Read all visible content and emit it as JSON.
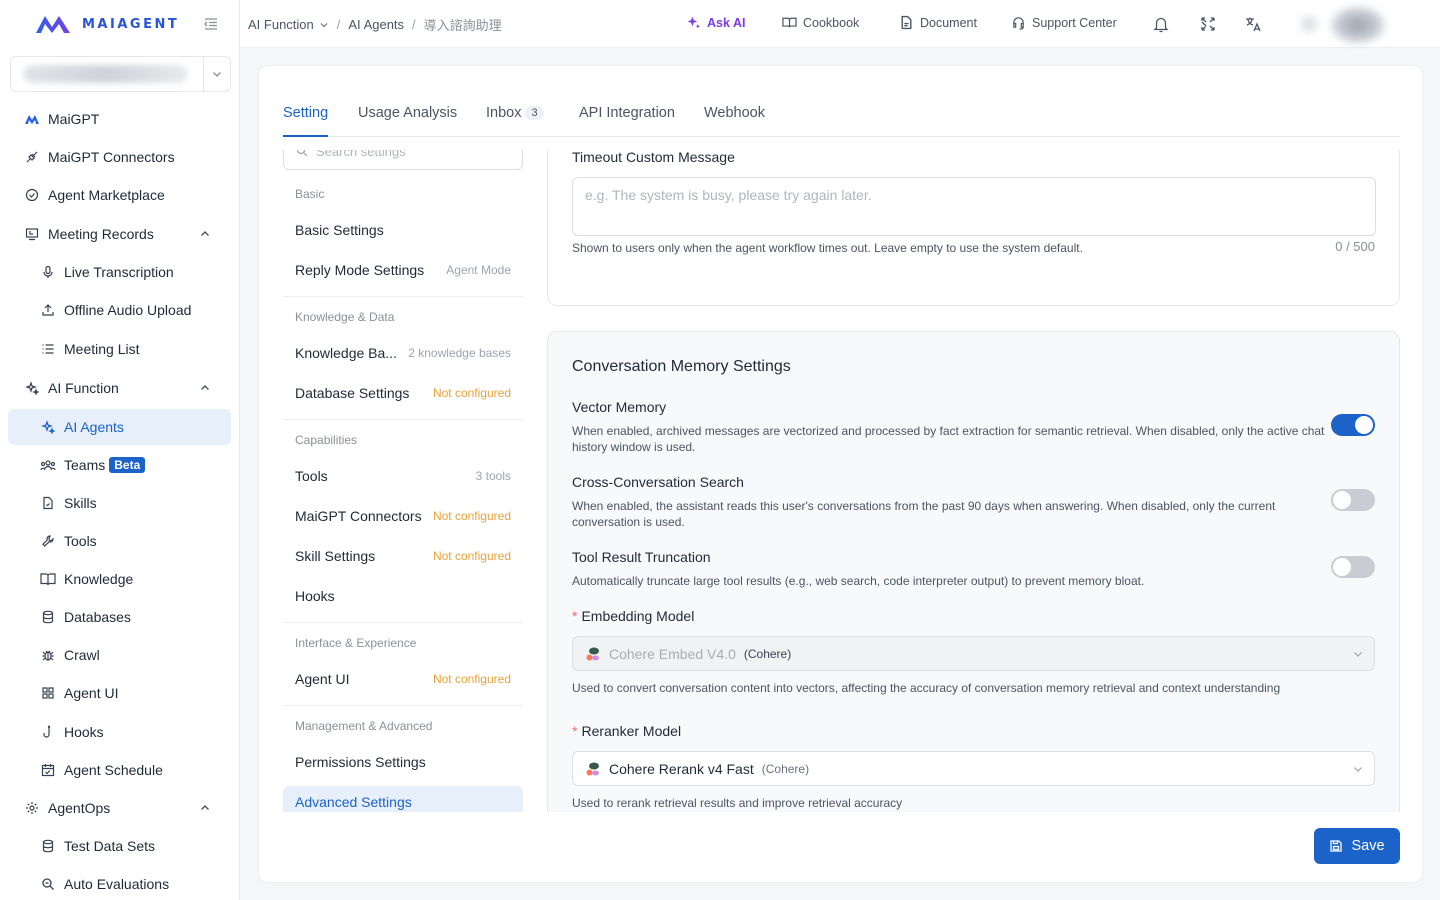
{
  "app": {
    "logo_text": "MAIAGENT"
  },
  "sidebar": {
    "items": [
      {
        "label": "MaiGPT",
        "icon": "maigpt-icon"
      },
      {
        "label": "MaiGPT Connectors",
        "icon": "connector-icon"
      },
      {
        "label": "Agent Marketplace",
        "icon": "marketplace-icon"
      },
      {
        "label": "Meeting Records",
        "icon": "meeting-icon",
        "expanded": true
      },
      {
        "label": "Live Transcription",
        "icon": "microphone-icon"
      },
      {
        "label": "Offline Audio Upload",
        "icon": "upload-icon"
      },
      {
        "label": "Meeting List",
        "icon": "list-icon"
      },
      {
        "label": "AI Function",
        "icon": "sparkle-icon",
        "expanded": true
      },
      {
        "label": "AI Agents",
        "icon": "sparkle-icon",
        "active": true
      },
      {
        "label": "Teams",
        "icon": "team-icon",
        "badge": "Beta"
      },
      {
        "label": "Skills",
        "icon": "skill-icon"
      },
      {
        "label": "Tools",
        "icon": "wrench-icon"
      },
      {
        "label": "Knowledge",
        "icon": "book-icon"
      },
      {
        "label": "Databases",
        "icon": "database-icon"
      },
      {
        "label": "Crawl",
        "icon": "bug-icon"
      },
      {
        "label": "Agent UI",
        "icon": "grid-icon"
      },
      {
        "label": "Hooks",
        "icon": "hook-icon"
      },
      {
        "label": "Agent Schedule",
        "icon": "calendar-icon"
      },
      {
        "label": "AgentOps",
        "icon": "agentops-icon",
        "expanded": true
      },
      {
        "label": "Test Data Sets",
        "icon": "database-icon"
      },
      {
        "label": "Auto Evaluations",
        "icon": "search-icon"
      }
    ]
  },
  "topbar": {
    "breadcrumb": [
      "AI Function",
      "AI Agents",
      "導入諮詢助理"
    ],
    "ask_ai": "Ask AI",
    "cookbook": "Cookbook",
    "document": "Document",
    "support": "Support Center"
  },
  "tabs": [
    {
      "label": "Setting",
      "active": true
    },
    {
      "label": "Usage Analysis"
    },
    {
      "label": "Inbox",
      "count": "3"
    },
    {
      "label": "API Integration"
    },
    {
      "label": "Webhook"
    }
  ],
  "settings_nav": {
    "search_placeholder": "Search settings",
    "groups": [
      {
        "title": "Basic",
        "items": [
          {
            "label": "Basic Settings",
            "meta": ""
          },
          {
            "label": "Reply Mode Settings",
            "meta": "Agent Mode"
          }
        ]
      },
      {
        "title": "Knowledge & Data",
        "items": [
          {
            "label": "Knowledge Ba...",
            "meta": "2 knowledge bases"
          },
          {
            "label": "Database Settings",
            "meta": "Not configured"
          }
        ]
      },
      {
        "title": "Capabilities",
        "items": [
          {
            "label": "Tools",
            "meta": "3 tools"
          },
          {
            "label": "MaiGPT Connectors",
            "meta": "Not configured"
          },
          {
            "label": "Skill Settings",
            "meta": "Not configured"
          },
          {
            "label": "Hooks",
            "meta": ""
          }
        ]
      },
      {
        "title": "Interface & Experience",
        "items": [
          {
            "label": "Agent UI",
            "meta": "Not configured"
          }
        ]
      },
      {
        "title": "Management & Advanced",
        "items": [
          {
            "label": "Permissions Settings",
            "meta": ""
          },
          {
            "label": "Advanced Settings",
            "meta": "",
            "active": true
          }
        ]
      }
    ]
  },
  "timeout": {
    "label": "Timeout Custom Message",
    "placeholder": "e.g. The system is busy, please try again later.",
    "help": "Shown to users only when the agent workflow times out. Leave empty to use the system default.",
    "count": "0 / 500"
  },
  "memory": {
    "title": "Conversation Memory Settings",
    "vector": {
      "title": "Vector Memory",
      "desc": "When enabled, archived messages are vectorized and processed by fact extraction for semantic retrieval. When disabled, only the active chat history window is used.",
      "enabled": true
    },
    "cross": {
      "title": "Cross-Conversation Search",
      "desc": "When enabled, the assistant reads this user's conversations from the past 90 days when answering. When disabled, only the current conversation is used.",
      "enabled": false
    },
    "truncation": {
      "title": "Tool Result Truncation",
      "desc": "Automatically truncate large tool results (e.g., web search, code interpreter output) to prevent memory bloat.",
      "enabled": false
    },
    "embedding": {
      "label": "Embedding Model",
      "value": "Cohere Embed V4.0",
      "provider": "(Cohere)",
      "help": "Used to convert conversation content into vectors, affecting the accuracy of conversation memory retrieval and context understanding"
    },
    "reranker": {
      "label": "Reranker Model",
      "value": "Cohere Rerank v4 Fast",
      "provider": "(Cohere)",
      "help": "Used to rerank retrieval results and improve retrieval accuracy"
    }
  },
  "save_label": "Save",
  "colors": {
    "primary": "#1b62c9",
    "warning": "#e6a23c",
    "ask_ai": "#7c3aed"
  }
}
